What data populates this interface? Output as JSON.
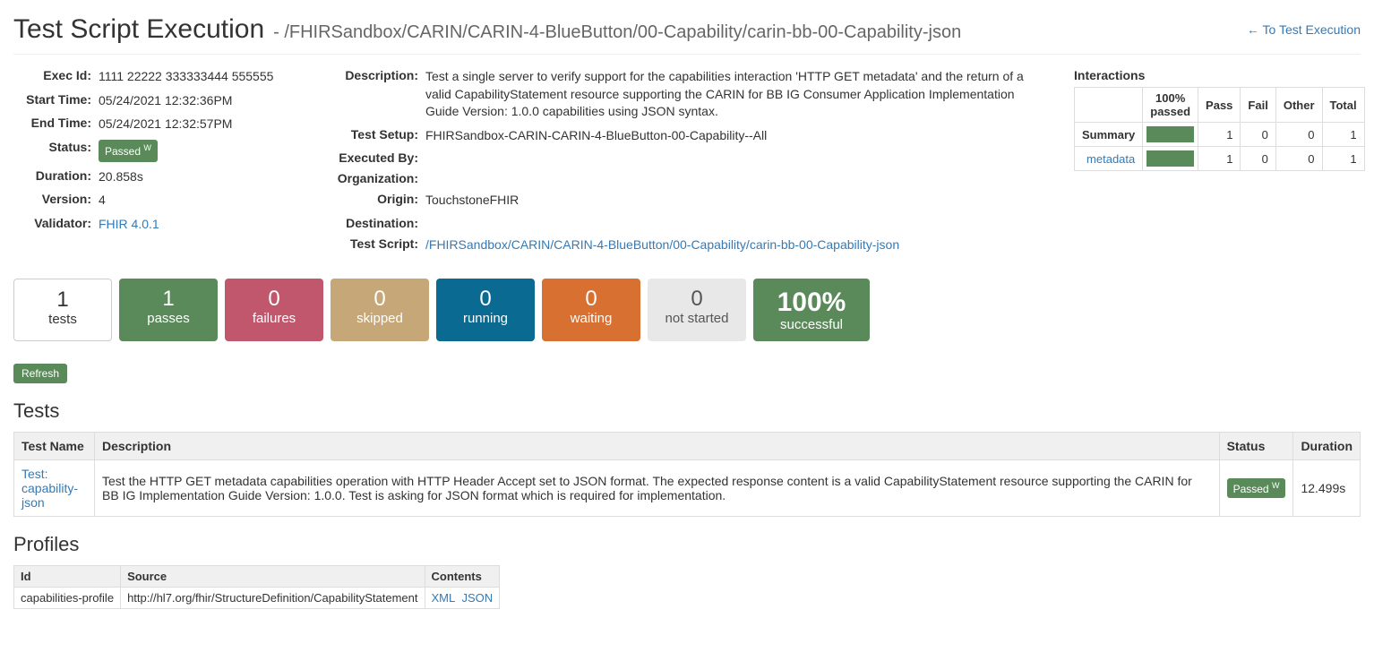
{
  "header": {
    "title": "Test Script Execution",
    "subtitle": "- /FHIRSandbox/CARIN/CARIN-4-BlueButton/00-Capability/carin-bb-00-Capability-json",
    "back_link": "To Test Execution"
  },
  "left": {
    "exec_id_label": "Exec Id:",
    "exec_id": "1111 22222 333333444 555555",
    "start_time_label": "Start Time:",
    "start_time": "05/24/2021 12:32:36PM",
    "end_time_label": "End Time:",
    "end_time": "05/24/2021 12:32:57PM",
    "status_label": "Status:",
    "status_badge": "Passed",
    "status_badge_sup": "W",
    "duration_label": "Duration:",
    "duration": "20.858s",
    "version_label": "Version:",
    "version": "4",
    "validator_label": "Validator:",
    "validator": "FHIR 4.0.1"
  },
  "mid": {
    "desc_label": "Description:",
    "desc": "Test a single server to verify support for the capabilities interaction 'HTTP GET metadata' and the return of a valid CapabilityStatement resource supporting the CARIN for BB IG Consumer Application Implementation Guide Version: 1.0.0 capabilities using JSON syntax.",
    "setup_label": "Test Setup:",
    "setup": "FHIRSandbox-CARIN-CARIN-4-BlueButton-00-Capability--All",
    "exec_by_label": "Executed By:",
    "exec_by": "",
    "org_label": "Organization:",
    "org": "",
    "origin_label": "Origin:",
    "origin": "TouchstoneFHIR",
    "dest_label": "Destination:",
    "dest": "",
    "script_label": "Test Script:",
    "script": "/FHIRSandbox/CARIN/CARIN-4-BlueButton/00-Capability/carin-bb-00-Capability-json"
  },
  "interactions": {
    "title": "Interactions",
    "cols": [
      "",
      "100% passed",
      "Pass",
      "Fail",
      "Other",
      "Total"
    ],
    "rows": [
      {
        "label": "Summary",
        "is_link": false,
        "pass": "1",
        "fail": "0",
        "other": "0",
        "total": "1"
      },
      {
        "label": "metadata",
        "is_link": true,
        "pass": "1",
        "fail": "0",
        "other": "0",
        "total": "1"
      }
    ]
  },
  "stats": {
    "tests": {
      "num": "1",
      "label": "tests"
    },
    "passes": {
      "num": "1",
      "label": "passes"
    },
    "failures": {
      "num": "0",
      "label": "failures"
    },
    "skipped": {
      "num": "0",
      "label": "skipped"
    },
    "running": {
      "num": "0",
      "label": "running"
    },
    "waiting": {
      "num": "0",
      "label": "waiting"
    },
    "notstarted": {
      "num": "0",
      "label": "not started"
    },
    "successful": {
      "num": "100%",
      "label": "successful"
    }
  },
  "refresh_label": "Refresh",
  "tests_section": {
    "title": "Tests",
    "cols": [
      "Test Name",
      "Description",
      "Status",
      "Duration"
    ],
    "row": {
      "name_prefix": "Test:",
      "name": "capability-json",
      "desc": "Test the HTTP GET metadata capabilities operation with HTTP Header Accept set to JSON format. The expected response content is a valid CapabilityStatement resource supporting the CARIN for BB IG Implementation Guide Version: 1.0.0. Test is asking for JSON format which is required for implementation.",
      "status": "Passed",
      "status_sup": "W",
      "duration": "12.499s"
    }
  },
  "profiles_section": {
    "title": "Profiles",
    "cols": [
      "Id",
      "Source",
      "Contents"
    ],
    "row": {
      "id": "capabilities-profile",
      "source": "http://hl7.org/fhir/StructureDefinition/CapabilityStatement",
      "xml": "XML",
      "json": "JSON"
    }
  }
}
